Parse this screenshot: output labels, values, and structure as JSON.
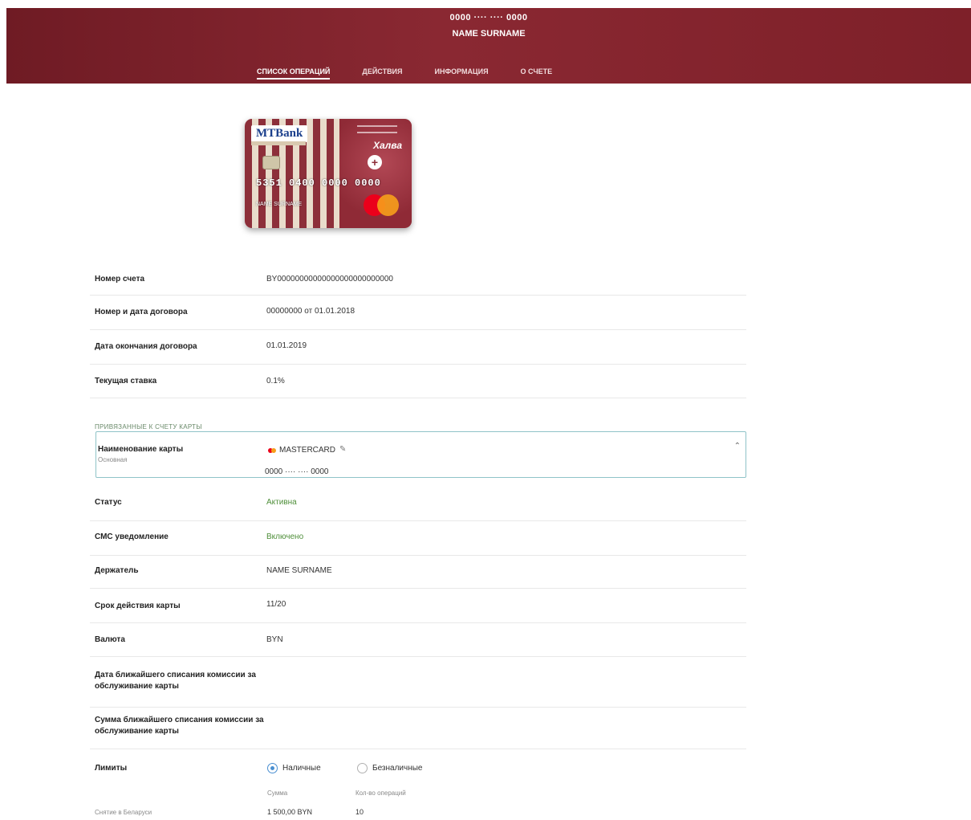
{
  "header": {
    "card_number": "0000 ···· ···· 0000",
    "holder_name": "NAME SURNAME",
    "tabs": [
      {
        "label": "список операций",
        "active": true
      },
      {
        "label": "действия",
        "active": false
      },
      {
        "label": "информация",
        "active": false
      },
      {
        "label": "о счете",
        "active": false
      }
    ]
  },
  "card_image": {
    "bank_logo": "MTBank",
    "brand": "Халва",
    "number": "5351 0400 0000 0000",
    "holder": "NAME SURNAME",
    "colors": {
      "stripe_red": "#8d2f3a",
      "stripe_beige": "#e9dccb"
    }
  },
  "account": {
    "rows": [
      {
        "label": "Номер счета",
        "value": "BY00000000000000000000000000"
      },
      {
        "label": "Номер и дата договора",
        "value": "00000000 от 01.01.2018"
      },
      {
        "label": "Дата окончания договора",
        "value": "01.01.2019"
      },
      {
        "label": "Текущая ставка",
        "value": "0.1%"
      }
    ]
  },
  "linked_cards": {
    "section_title": "привязанные к счету карты",
    "card_select": {
      "label": "Наименование карты",
      "sublabel": "Основная",
      "type": "MASTERCARD",
      "number": "0000 ···· ···· 0000",
      "edit_icon": "pencil-icon",
      "chevron_icon": "chevron-up-icon"
    },
    "rows": [
      {
        "label": "Статус",
        "value": "Активна",
        "green": true
      },
      {
        "label": "СМС уведомление",
        "value": "Включено",
        "green": true
      },
      {
        "label": "Держатель",
        "value": "NAME SURNAME",
        "green": false
      },
      {
        "label": "Срок действия карты",
        "value": "11/20",
        "green": false
      },
      {
        "label": "Валюта",
        "value": "BYN",
        "green": false
      },
      {
        "label": "Дата ближайшего списания комиссии за обслуживание карты",
        "value": "",
        "green": false
      },
      {
        "label": "Сумма ближайшего списания комиссии за обслуживание карты",
        "value": "",
        "green": false
      }
    ]
  },
  "limits": {
    "label": "Лимиты",
    "options": [
      {
        "label": "Наличные",
        "checked": true
      },
      {
        "label": "Безналичные",
        "checked": false
      }
    ],
    "col_sum": "Сумма",
    "col_count": "Кол-во операций",
    "row_label": "Снятие в Беларуси",
    "row_sum": "1 500,00 BYN",
    "row_count": "10"
  }
}
